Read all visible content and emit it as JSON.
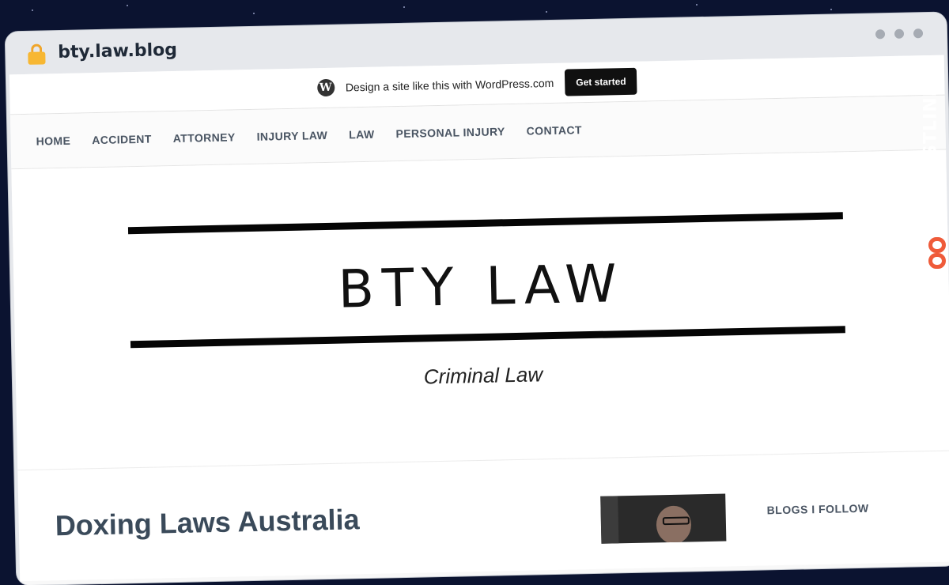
{
  "browser": {
    "url": "bty.law.blog",
    "lock_icon": "lock-icon"
  },
  "wordpress_bar": {
    "text": "Design a site like this with WordPress.com",
    "button": "Get started",
    "logo": "W"
  },
  "nav": {
    "items": [
      "HOME",
      "ACCIDENT",
      "ATTORNEY",
      "INJURY LAW",
      "LAW",
      "PERSONAL INJURY",
      "CONTACT"
    ]
  },
  "header": {
    "title": "BTY LAW",
    "tagline": "Criminal Law"
  },
  "post": {
    "title": "Doxing Laws Australia"
  },
  "sidebar": {
    "heading": "BLOGS I FOLLOW"
  },
  "watermark": {
    "text": "GUESTPOSTLINKS",
    "accent": "#ef5b3a"
  }
}
